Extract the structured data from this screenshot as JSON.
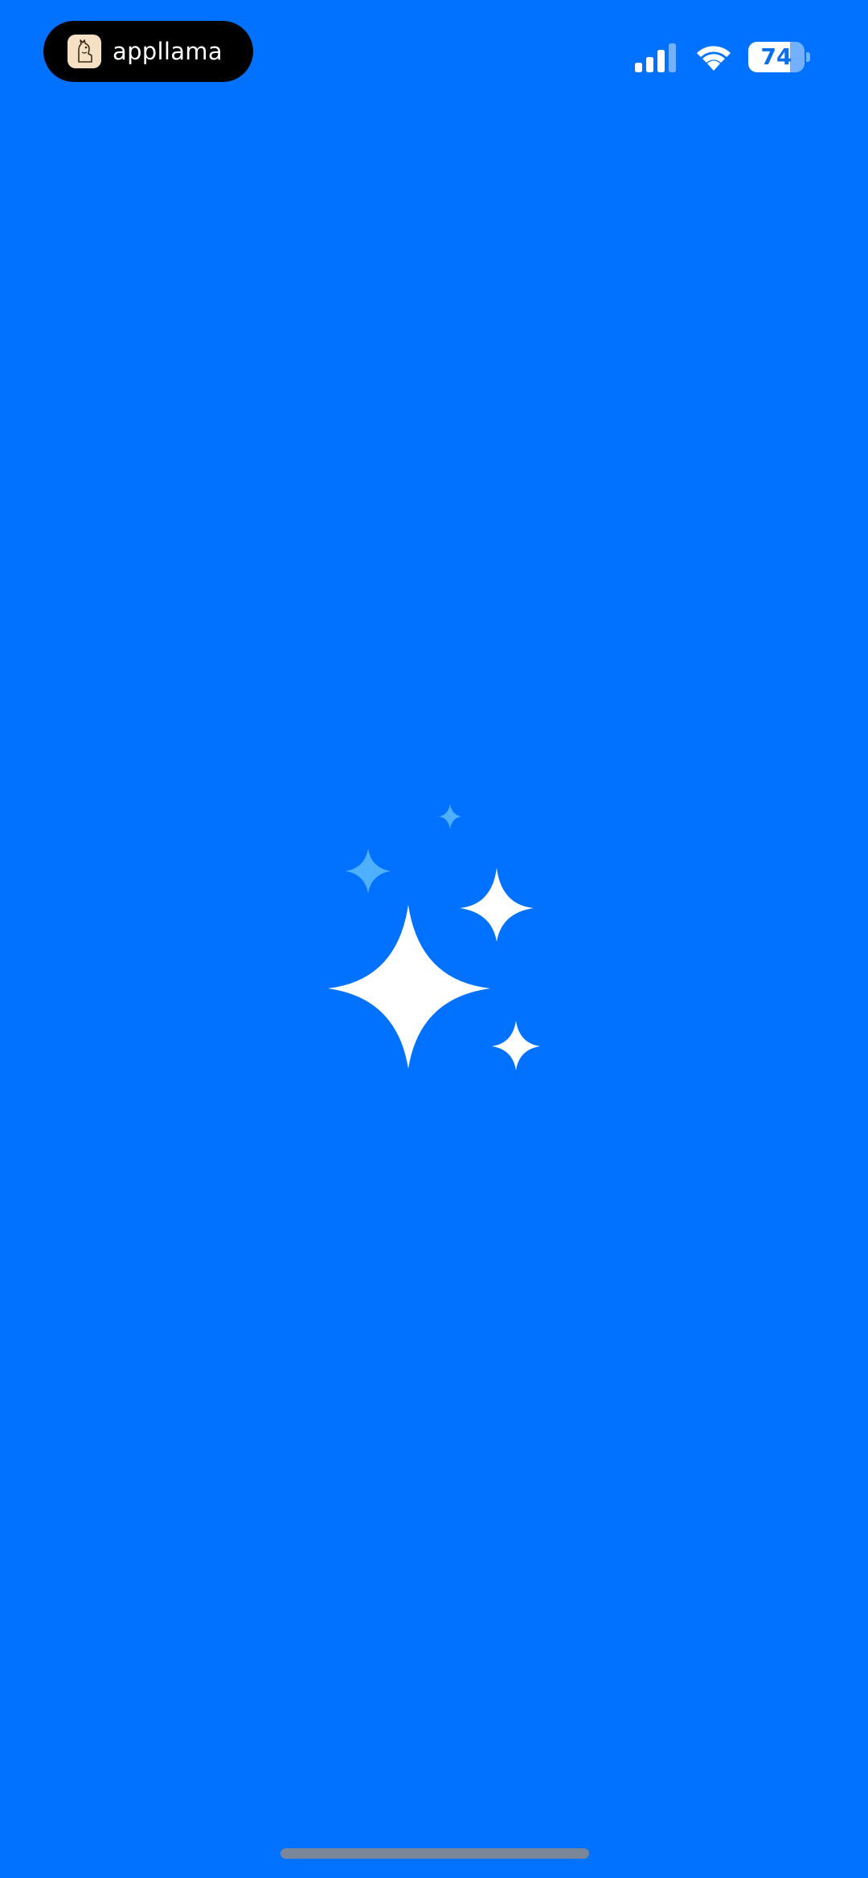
{
  "colors": {
    "background": "#0072FF",
    "sparkle_primary": "#FFFFFF",
    "sparkle_secondary": "#4FB0FF",
    "pill_background": "#000000",
    "home_indicator": "#7A8699"
  },
  "status_bar": {
    "app_name": "appllama",
    "app_icon": "llama-icon",
    "signal_icon": "cellular-signal-icon",
    "wifi_icon": "wifi-icon",
    "battery_icon": "battery-icon",
    "battery_level": "74",
    "battery_fraction": 0.74
  },
  "content": {
    "illustration_icon": "sparkles-icon"
  }
}
